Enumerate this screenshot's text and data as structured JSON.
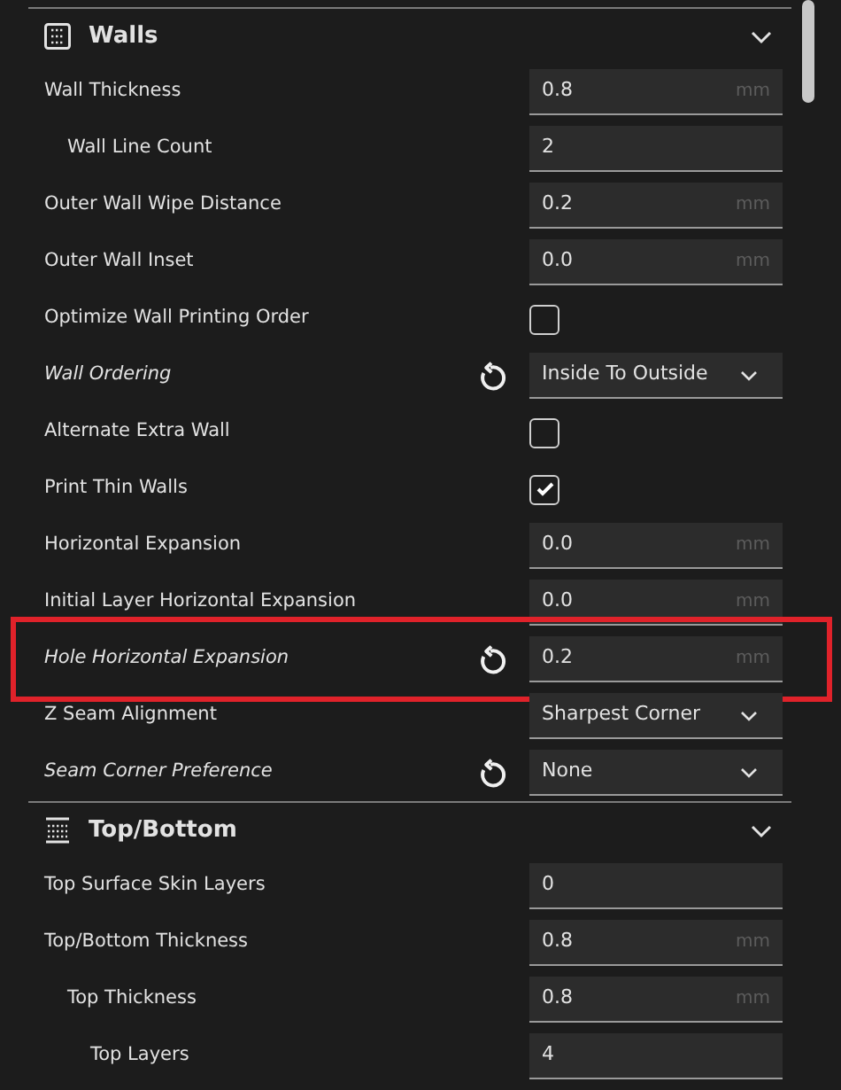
{
  "sections": [
    {
      "title": "Walls",
      "expanded": true,
      "settings": [
        {
          "label": "Wall Thickness",
          "kind": "number",
          "value": "0.8",
          "unit": "mm",
          "modified": false,
          "children": [
            {
              "label": "Wall Line Count",
              "kind": "number",
              "value": "2",
              "modified": false
            }
          ]
        },
        {
          "label": "Outer Wall Wipe Distance",
          "kind": "number",
          "value": "0.2",
          "unit": "mm",
          "modified": false
        },
        {
          "label": "Outer Wall Inset",
          "kind": "number",
          "value": "0.0",
          "unit": "mm",
          "modified": false
        },
        {
          "label": "Optimize Wall Printing Order",
          "kind": "checkbox",
          "checked": false,
          "modified": false
        },
        {
          "label": "Wall Ordering",
          "kind": "dropdown",
          "value": "Inside To Outside",
          "modified": true
        },
        {
          "label": "Alternate Extra Wall",
          "kind": "checkbox",
          "checked": false,
          "modified": false
        },
        {
          "label": "Print Thin Walls",
          "kind": "checkbox",
          "checked": true,
          "modified": false
        },
        {
          "label": "Horizontal Expansion",
          "kind": "number",
          "value": "0.0",
          "unit": "mm",
          "modified": false
        },
        {
          "label": "Initial Layer Horizontal Expansion",
          "kind": "number",
          "value": "0.0",
          "unit": "mm",
          "modified": false
        },
        {
          "label": "Hole Horizontal Expansion",
          "kind": "number",
          "value": "0.2",
          "unit": "mm",
          "modified": true,
          "highlighted": true
        },
        {
          "label": "Z Seam Alignment",
          "kind": "dropdown",
          "value": "Sharpest Corner",
          "modified": false
        },
        {
          "label": "Seam Corner Preference",
          "kind": "dropdown",
          "value": "None",
          "modified": true
        }
      ]
    },
    {
      "title": "Top/Bottom",
      "expanded": true,
      "settings": [
        {
          "label": "Top Surface Skin Layers",
          "kind": "number",
          "value": "0",
          "modified": false
        },
        {
          "label": "Top/Bottom Thickness",
          "kind": "number",
          "value": "0.8",
          "unit": "mm",
          "modified": false,
          "children": [
            {
              "label": "Top Thickness",
              "kind": "number",
              "value": "0.8",
              "unit": "mm",
              "modified": false,
              "children": [
                {
                  "label": "Top Layers",
                  "kind": "number",
                  "value": "4",
                  "modified": false
                }
              ]
            }
          ]
        }
      ]
    }
  ]
}
